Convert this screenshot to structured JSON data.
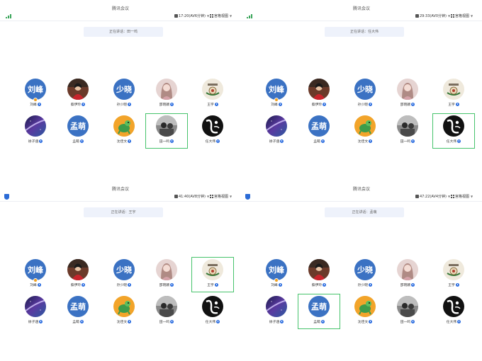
{
  "colors": {
    "accent": "#3b72c3",
    "highlight": "#46c36b",
    "host_badge": "#f0a020",
    "mic": "#2f6fe0"
  },
  "panels": [
    {
      "title": "腾讯会议",
      "time": "17:20(AV6分钟)",
      "view": "宫格视图",
      "speaker": "正在讲话：田一鸣",
      "participants": [
        {
          "avatar_text": "刘峰",
          "name": "刘峰",
          "host": true
        },
        {
          "avatar_text": "",
          "name": "蔡伊玲",
          "host": false,
          "img": "portrait"
        },
        {
          "avatar_text": "少晓",
          "name": "孙少晓",
          "host": false
        },
        {
          "avatar_text": "",
          "name": "邵晓颖",
          "host": false,
          "img": "girl"
        },
        {
          "avatar_text": "",
          "name": "王宇",
          "host": false,
          "img": "seal"
        },
        {
          "avatar_text": "",
          "name": "徐子涵",
          "host": false,
          "img": "galaxy"
        },
        {
          "avatar_text": "孟萌",
          "name": "孟萌",
          "host": false
        },
        {
          "avatar_text": "",
          "name": "沈佳文",
          "host": false,
          "img": "turtle"
        },
        {
          "avatar_text": "",
          "name": "田一鸣",
          "host": false,
          "img": "bw",
          "active": true
        },
        {
          "avatar_text": "",
          "name": "任大伟",
          "host": false,
          "img": "ink"
        }
      ]
    },
    {
      "title": "腾讯会议",
      "time": "29:33(AV0分钟)",
      "view": "宫格视图",
      "speaker": "正在讲话：任大伟",
      "participants": [
        {
          "avatar_text": "刘峰",
          "name": "刘峰",
          "host": true
        },
        {
          "avatar_text": "",
          "name": "蔡伊玲",
          "host": false,
          "img": "portrait"
        },
        {
          "avatar_text": "少晓",
          "name": "孙少晓",
          "host": false
        },
        {
          "avatar_text": "",
          "name": "邵晓颖",
          "host": false,
          "img": "girl"
        },
        {
          "avatar_text": "",
          "name": "王宇",
          "host": false,
          "img": "seal"
        },
        {
          "avatar_text": "",
          "name": "徐子涵",
          "host": false,
          "img": "galaxy"
        },
        {
          "avatar_text": "孟萌",
          "name": "孟萌",
          "host": false
        },
        {
          "avatar_text": "",
          "name": "沈佳文",
          "host": false,
          "img": "turtle"
        },
        {
          "avatar_text": "",
          "name": "田一鸣",
          "host": false,
          "img": "bw"
        },
        {
          "avatar_text": "",
          "name": "任大伟",
          "host": false,
          "img": "ink",
          "active": true
        }
      ]
    },
    {
      "title": "腾讯会议",
      "time": "41:40(AV8分钟)",
      "view": "宫格视图",
      "speaker": "正在讲话：王宇",
      "participants": [
        {
          "avatar_text": "刘峰",
          "name": "刘峰",
          "host": true
        },
        {
          "avatar_text": "",
          "name": "蔡伊玲",
          "host": false,
          "img": "portrait"
        },
        {
          "avatar_text": "少晓",
          "name": "孙少晓",
          "host": false
        },
        {
          "avatar_text": "",
          "name": "邵晓颖",
          "host": false,
          "img": "girl"
        },
        {
          "avatar_text": "",
          "name": "王宇",
          "host": false,
          "img": "seal",
          "active": true
        },
        {
          "avatar_text": "",
          "name": "徐子涵",
          "host": false,
          "img": "galaxy"
        },
        {
          "avatar_text": "孟萌",
          "name": "孟萌",
          "host": false
        },
        {
          "avatar_text": "",
          "name": "沈佳文",
          "host": false,
          "img": "turtle"
        },
        {
          "avatar_text": "",
          "name": "田一鸣",
          "host": false,
          "img": "bw"
        },
        {
          "avatar_text": "",
          "name": "任大伟",
          "host": false,
          "img": "ink"
        }
      ]
    },
    {
      "title": "腾讯会议",
      "time": "47:22(AV4分钟)",
      "view": "宫格视图",
      "speaker": "正在讲话：孟萌",
      "participants": [
        {
          "avatar_text": "刘峰",
          "name": "刘峰",
          "host": true
        },
        {
          "avatar_text": "",
          "name": "蔡伊玲",
          "host": false,
          "img": "portrait"
        },
        {
          "avatar_text": "少晓",
          "name": "孙少晓",
          "host": false
        },
        {
          "avatar_text": "",
          "name": "邵晓颖",
          "host": false,
          "img": "girl"
        },
        {
          "avatar_text": "",
          "name": "王宇",
          "host": false,
          "img": "seal"
        },
        {
          "avatar_text": "",
          "name": "徐子涵",
          "host": false,
          "img": "galaxy"
        },
        {
          "avatar_text": "孟萌",
          "name": "孟萌",
          "host": false,
          "active": true
        },
        {
          "avatar_text": "",
          "name": "沈佳文",
          "host": false,
          "img": "turtle"
        },
        {
          "avatar_text": "",
          "name": "田一鸣",
          "host": false,
          "img": "bw"
        },
        {
          "avatar_text": "",
          "name": "任大伟",
          "host": false,
          "img": "ink"
        }
      ]
    }
  ]
}
